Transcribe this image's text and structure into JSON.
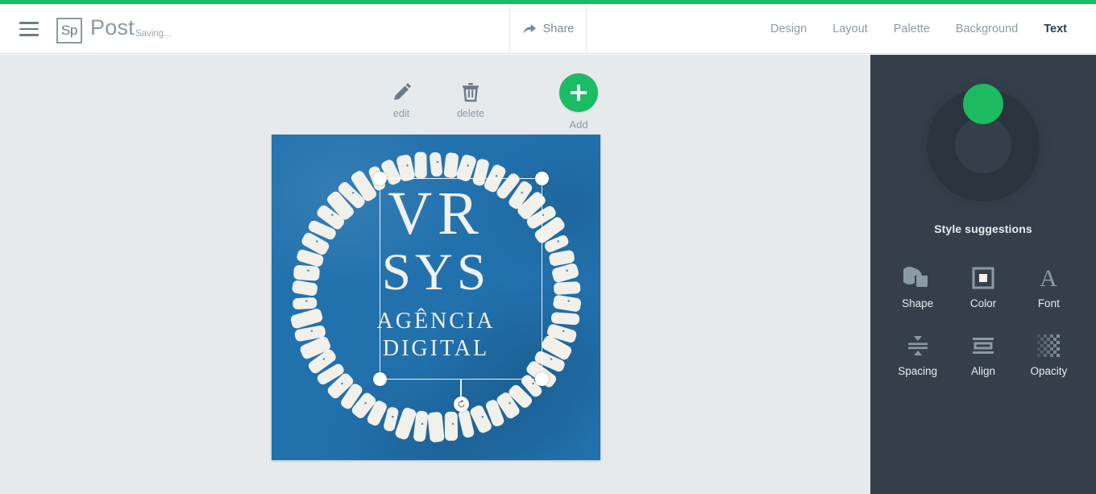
{
  "theme": {
    "accent_green": "#18bc62",
    "sidebar_bg": "#343f4b",
    "stage_bg": "#e7eaec",
    "artwork_blue": "#2171ad",
    "muted_text": "#8b99a7"
  },
  "header": {
    "menu_icon": "hamburger-icon",
    "logo_text": "Sp",
    "doc_title": "Post",
    "save_status": "Saving...",
    "share": {
      "label": "Share",
      "icon": "share-arrow-icon"
    },
    "nav_items": [
      {
        "label": "Design",
        "active": false
      },
      {
        "label": "Layout",
        "active": false
      },
      {
        "label": "Palette",
        "active": false
      },
      {
        "label": "Background",
        "active": false
      },
      {
        "label": "Text",
        "active": true
      }
    ]
  },
  "object_toolbar": {
    "edit": {
      "label": "edit",
      "icon": "pencil-icon"
    },
    "delete": {
      "label": "delete",
      "icon": "trash-icon"
    },
    "add": {
      "label": "Add",
      "icon": "plus-icon"
    }
  },
  "artwork": {
    "line1": "VR",
    "line2": "SYS",
    "line3": "AGÊNCIA",
    "line4": "DIGITAL",
    "selection": {
      "rotate_icon": "rotate-icon",
      "handles": 4
    }
  },
  "sidebar": {
    "dial": {
      "name": "style-suggestions-dial",
      "knob_color": "#1dbb5f"
    },
    "caption": "Style suggestions",
    "tools": [
      {
        "label": "Shape",
        "icon": "shape-icon"
      },
      {
        "label": "Color",
        "icon": "color-swatch-icon"
      },
      {
        "label": "Font",
        "icon": "font-icon"
      },
      {
        "label": "Spacing",
        "icon": "spacing-icon"
      },
      {
        "label": "Align",
        "icon": "align-icon"
      },
      {
        "label": "Opacity",
        "icon": "opacity-checker-icon"
      }
    ]
  }
}
